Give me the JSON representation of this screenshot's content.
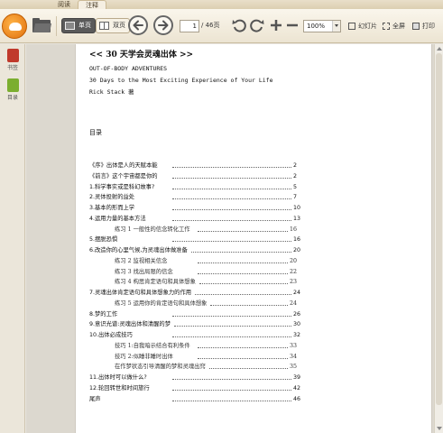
{
  "tabs": [
    {
      "label": "阅读",
      "active": false
    },
    {
      "label": "注释",
      "active": true
    }
  ],
  "toolbar": {
    "single_page_label": "单页",
    "double_page_label": "双页",
    "page_current": "1",
    "page_total": "/ 46页",
    "zoom_value": "100%",
    "slideshow_label": "幻灯片",
    "fullscreen_label": "全屏",
    "print_label": "打印"
  },
  "sidebar": {
    "items": [
      {
        "label": "书签",
        "icon": "bookmark-icon",
        "color": "#c0392b"
      },
      {
        "label": "目录",
        "icon": "toc-icon",
        "color": "#7bae2f"
      }
    ]
  },
  "doc": {
    "title": "<< 30 天学会灵魂出体 >>",
    "subtitle_en": "OUT-OF-BODY ADVENTURES",
    "tagline_en": "30 Days to the Most Exciting Experience of Your Life",
    "author": "Rick Stack 著",
    "toc_heading": "目录",
    "toc": [
      {
        "label": "《序》出体是人的天赋本能",
        "page": "2",
        "level": 0
      },
      {
        "label": "《前言》这个宇宙都是你的",
        "page": "2",
        "level": 0
      },
      {
        "label": "1.科学事实或是科幻故事?",
        "page": "5",
        "level": 0
      },
      {
        "label": "2.灵体投射的益处",
        "page": "7",
        "level": 0
      },
      {
        "label": "3.基本的形而上学",
        "page": "10",
        "level": 0
      },
      {
        "label": "4.运用力量的基本方法",
        "page": "13",
        "level": 0
      },
      {
        "label": "练习 1   一般性的信念转化工作",
        "page": "16",
        "level": 1
      },
      {
        "label": "5.摆脱恐惧",
        "page": "16",
        "level": 0
      },
      {
        "label": "6.改造你的心里气候,为灵魂出体做准备",
        "page": "20",
        "level": 0
      },
      {
        "label": "练习 2   监视相关信念",
        "page": "20",
        "level": 1
      },
      {
        "label": "练习 3   找出局限的信念",
        "page": "22",
        "level": 1
      },
      {
        "label": "练习 4   构思肯定语句和具体想象",
        "page": "23",
        "level": 1
      },
      {
        "label": "7.灵魂出体肯定语句和具体想象力的作用",
        "page": "24",
        "level": 0
      },
      {
        "label": "练习 5   运用你的肯定语句和具体想象",
        "page": "24",
        "level": 1
      },
      {
        "label": "8.梦的工作",
        "page": "26",
        "level": 0
      },
      {
        "label": "9.意识光谱:灵魂出体和清醒的梦",
        "page": "30",
        "level": 0
      },
      {
        "label": "10.出体必成技巧",
        "page": "32",
        "level": 0
      },
      {
        "label": "技巧 1:自我暗示结合有利条件",
        "page": "33",
        "level": 1
      },
      {
        "label": "技巧 2:似睡非睡时出体",
        "page": "34",
        "level": 1
      },
      {
        "label": "在作梦状态引导清醒的梦和灵魂出窍",
        "page": "35",
        "level": 1
      },
      {
        "label": "11.出体时可以做什么?",
        "page": "39",
        "level": 0
      },
      {
        "label": "12.轮回转世和时间旅行",
        "page": "42",
        "level": 0
      },
      {
        "label": "尾声",
        "page": "46",
        "level": 0
      }
    ]
  }
}
